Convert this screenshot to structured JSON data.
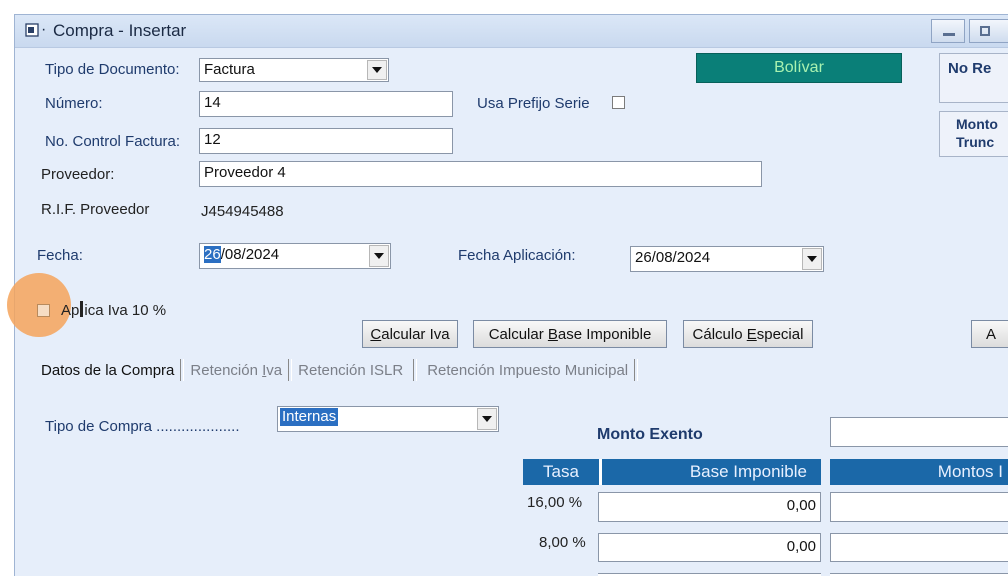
{
  "window": {
    "title": "Compra - Insertar"
  },
  "region": {
    "label": "Bolívar",
    "color": "#0a7f78"
  },
  "right_panel": {
    "top_label": "No Re",
    "monto_label_1": "Monto",
    "monto_label_2": "Trunc"
  },
  "form": {
    "tipo_documento": {
      "label": "Tipo de Documento:",
      "value": "Factura"
    },
    "numero": {
      "label": "Número:",
      "value": "14"
    },
    "usa_prefijo": {
      "label": "Usa Prefijo Serie"
    },
    "no_control": {
      "label": "No. Control Factura:",
      "value": "12"
    },
    "proveedor": {
      "label": "Proveedor:",
      "value": "Proveedor 4"
    },
    "rif": {
      "label": "R.I.F. Proveedor",
      "value": "J454945488"
    },
    "fecha": {
      "label": "Fecha:",
      "value_selected": "26",
      "value_rest": "/08/2024"
    },
    "fecha_aplicacion": {
      "label": "Fecha Aplicación:",
      "value": "26/08/2024"
    },
    "aplica_iva": {
      "label_a": "Ap",
      "label_b": "ica Iva 10 %"
    }
  },
  "buttons": {
    "calcular_iva": {
      "pre": "",
      "u": "C",
      "post": "alcular Iva"
    },
    "calcular_base": {
      "pre": "Calcular ",
      "u": "B",
      "post": "ase Imponible"
    },
    "calculo_especial": {
      "pre": "Cálculo ",
      "u": "E",
      "post": "special"
    },
    "right_cut": "A"
  },
  "tabs": [
    {
      "pre": "Datos de la Compra",
      "u": "",
      "post": ""
    },
    {
      "pre": "Retención ",
      "u": "I",
      "post": "va"
    },
    {
      "pre": "Retención ISLR",
      "u": "",
      "post": ""
    },
    {
      "pre": "Retención Impuesto Municipal",
      "u": "",
      "post": ""
    }
  ],
  "compra": {
    "tipo_compra": {
      "label": "Tipo de Compra ....................",
      "value": "Internas"
    },
    "monto_exento": {
      "label": "Monto Exento",
      "value": ""
    }
  },
  "tax_table": {
    "headers": {
      "tasa": "Tasa",
      "base": "Base Imponible",
      "montos": "Montos I"
    },
    "rows": [
      {
        "tasa": "16,00 %",
        "base": "0,00",
        "monto": ""
      },
      {
        "tasa": "8,00 %",
        "base": "0,00",
        "monto": ""
      }
    ]
  },
  "colors": {
    "header_blue": "#1b68a8",
    "label_blue": "#1f3b6d",
    "highlight_orange": "#f4a35a"
  }
}
